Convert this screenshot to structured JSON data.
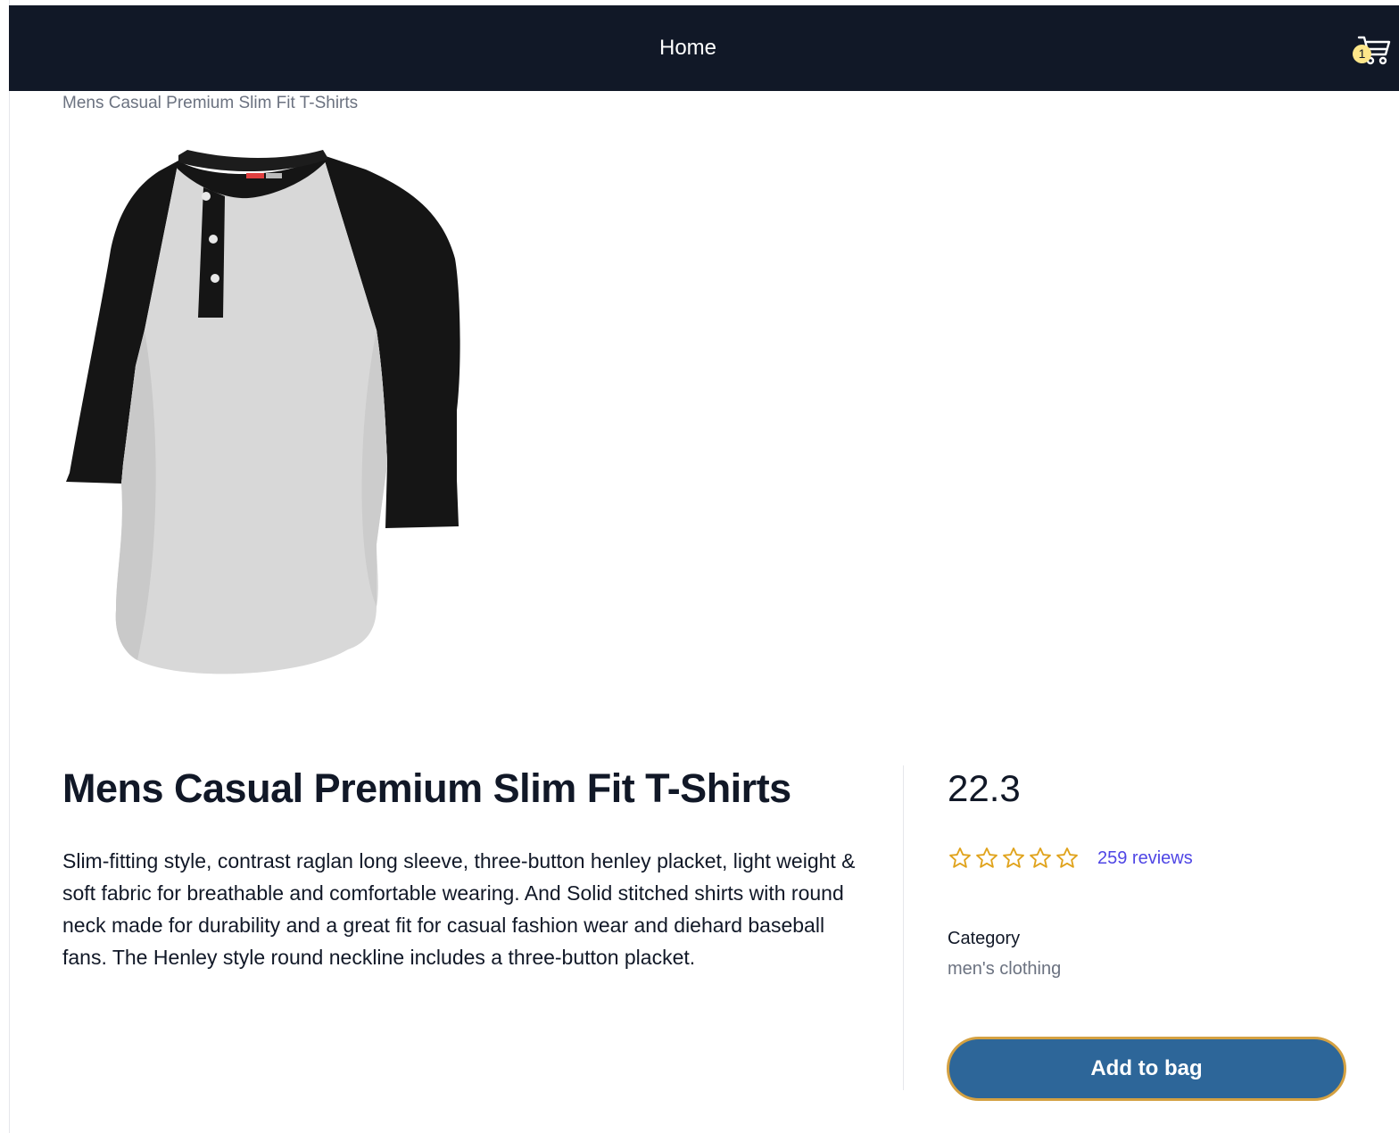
{
  "nav": {
    "home_label": "Home",
    "cart_count": "1"
  },
  "breadcrumb": {
    "current": "Mens Casual Premium Slim Fit T-Shirts"
  },
  "product": {
    "title": "Mens Casual Premium Slim Fit T-Shirts",
    "description": "Slim-fitting style, contrast raglan long sleeve, three-button henley placket, light weight & soft fabric for breathable and comfortable wearing. And Solid stitched shirts with round neck made for durability and a great fit for casual fashion wear and diehard baseball fans. The Henley style round neckline includes a three-button placket.",
    "price": "22.3",
    "rating": {
      "filled_stars": 0,
      "max_stars": 5,
      "reviews_label": "259 reviews"
    },
    "category_label": "Category",
    "category_value": "men's clothing",
    "add_to_bag_label": "Add to bag",
    "image_icon": "shirt-image"
  },
  "colors": {
    "navbar": "#111827",
    "button": "#2d6699",
    "button_border": "#d4a142",
    "star": "#e0a31c",
    "reviews_link": "#4f46e5",
    "cart_badge": "#fde68a"
  }
}
